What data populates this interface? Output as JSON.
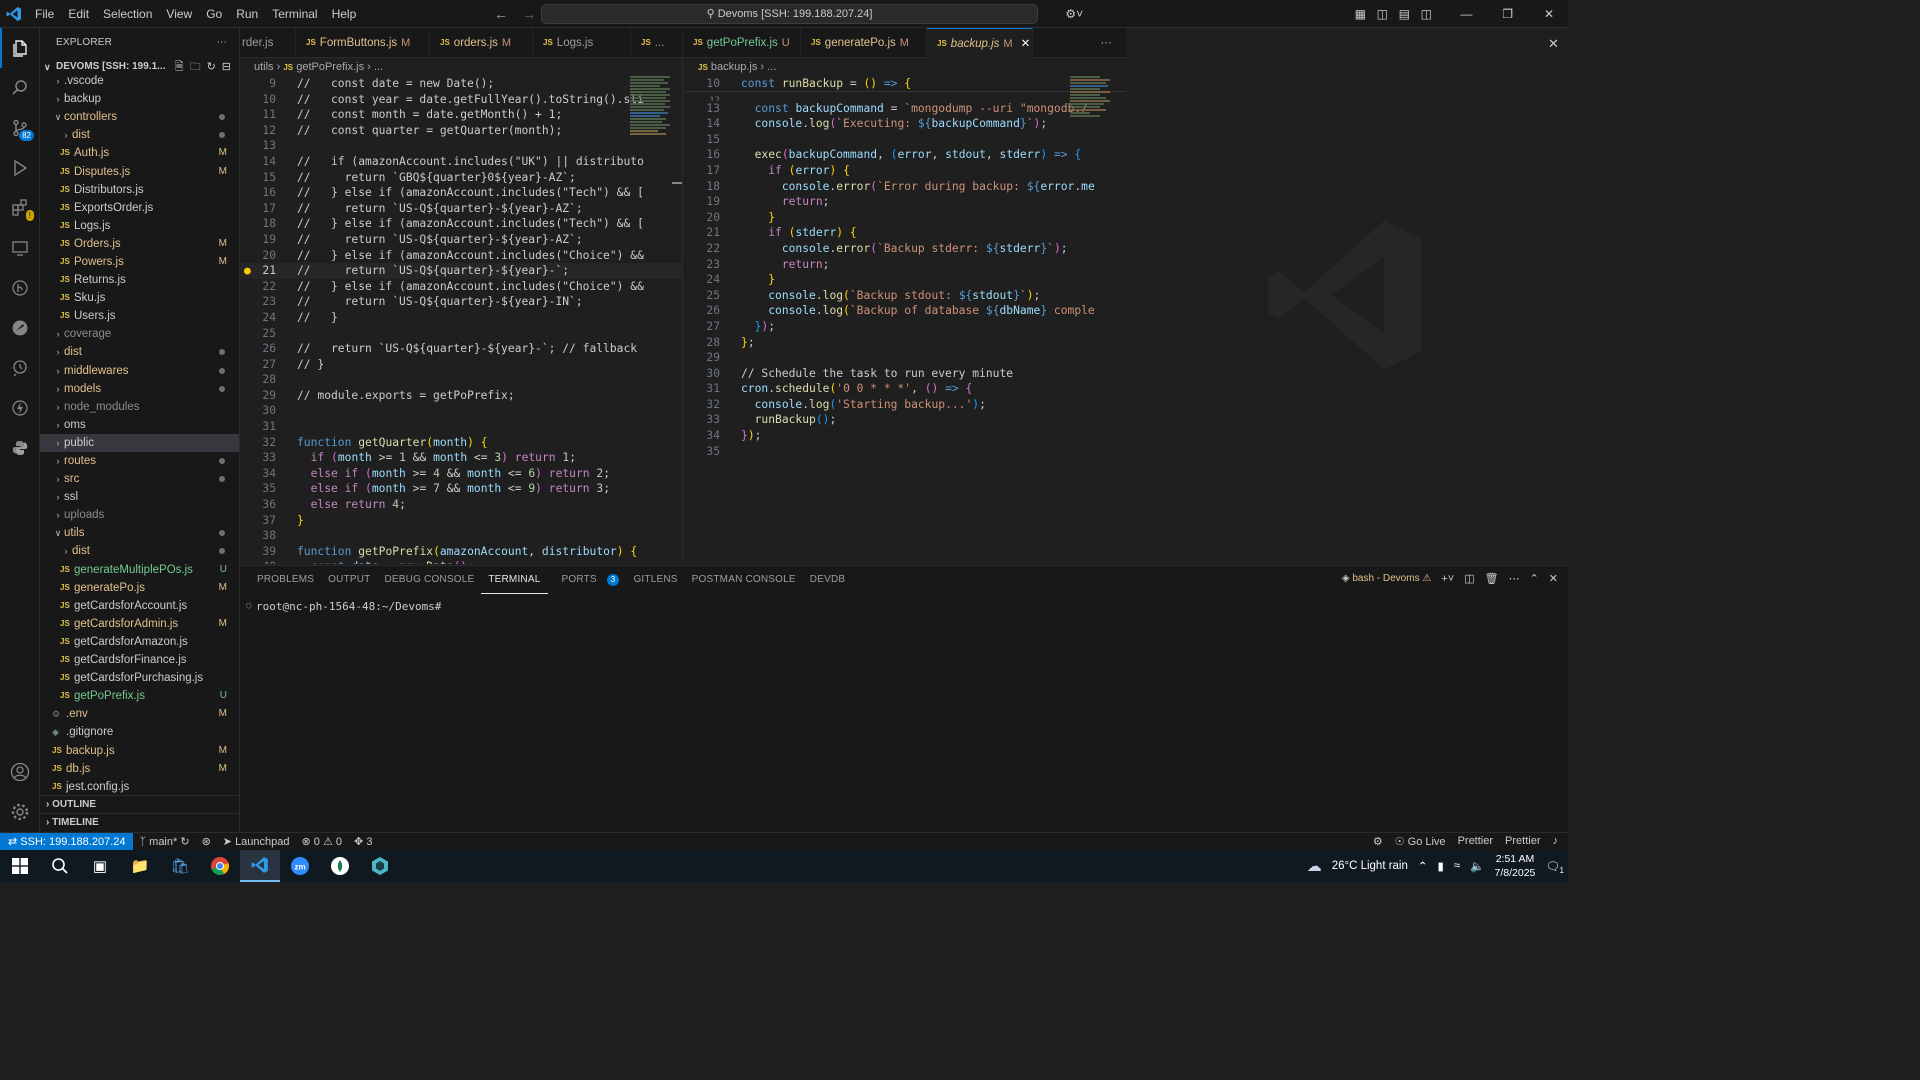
{
  "titlebar": {
    "menu": [
      "File",
      "Edit",
      "Selection",
      "View",
      "Go",
      "Run",
      "Terminal",
      "Help"
    ],
    "search": "Devoms [SSH: 199.188.207.24]"
  },
  "activity": {
    "source_control_badge": "82"
  },
  "explorer": {
    "title": "EXPLORER",
    "workspace": "DEVOMS [SSH: 199.1...",
    "items": [
      {
        "label": ".vscode",
        "type": "folder",
        "depth": 0,
        "color": "def"
      },
      {
        "label": "backup",
        "type": "folder",
        "depth": 0,
        "color": "def"
      },
      {
        "label": "controllers",
        "type": "folder-open",
        "depth": 0,
        "color": "mod",
        "dot": true
      },
      {
        "label": "dist",
        "type": "folder",
        "depth": 1,
        "color": "mod",
        "dot": true
      },
      {
        "label": "Auth.js",
        "type": "js",
        "depth": 1,
        "color": "mod",
        "badge": "M"
      },
      {
        "label": "Disputes.js",
        "type": "js",
        "depth": 1,
        "color": "mod",
        "badge": "M"
      },
      {
        "label": "Distributors.js",
        "type": "js",
        "depth": 1,
        "color": "def"
      },
      {
        "label": "ExportsOrder.js",
        "type": "js",
        "depth": 1,
        "color": "def"
      },
      {
        "label": "Logs.js",
        "type": "js",
        "depth": 1,
        "color": "def"
      },
      {
        "label": "Orders.js",
        "type": "js",
        "depth": 1,
        "color": "mod",
        "badge": "M"
      },
      {
        "label": "Powers.js",
        "type": "js",
        "depth": 1,
        "color": "mod",
        "badge": "M"
      },
      {
        "label": "Returns.js",
        "type": "js",
        "depth": 1,
        "color": "def"
      },
      {
        "label": "Sku.js",
        "type": "js",
        "depth": 1,
        "color": "def"
      },
      {
        "label": "Users.js",
        "type": "js",
        "depth": 1,
        "color": "def"
      },
      {
        "label": "coverage",
        "type": "folder",
        "depth": 0,
        "color": "ign"
      },
      {
        "label": "dist",
        "type": "folder",
        "depth": 0,
        "color": "mod",
        "dot": true
      },
      {
        "label": "middlewares",
        "type": "folder",
        "depth": 0,
        "color": "mod",
        "dot": true
      },
      {
        "label": "models",
        "type": "folder",
        "depth": 0,
        "color": "mod",
        "dot": true
      },
      {
        "label": "node_modules",
        "type": "folder",
        "depth": 0,
        "color": "ign"
      },
      {
        "label": "oms",
        "type": "folder",
        "depth": 0,
        "color": "def"
      },
      {
        "label": "public",
        "type": "folder",
        "depth": 0,
        "color": "def",
        "selected": true
      },
      {
        "label": "routes",
        "type": "folder",
        "depth": 0,
        "color": "mod",
        "dot": true
      },
      {
        "label": "src",
        "type": "folder",
        "depth": 0,
        "color": "mod",
        "dot": true
      },
      {
        "label": "ssl",
        "type": "folder",
        "depth": 0,
        "color": "def"
      },
      {
        "label": "uploads",
        "type": "folder",
        "depth": 0,
        "color": "ign"
      },
      {
        "label": "utils",
        "type": "folder-open",
        "depth": 0,
        "color": "mod",
        "dot": true
      },
      {
        "label": "dist",
        "type": "folder",
        "depth": 1,
        "color": "mod",
        "dot": true
      },
      {
        "label": "generateMultiplePOs.js",
        "type": "js",
        "depth": 1,
        "color": "new",
        "badge": "U"
      },
      {
        "label": "generatePo.js",
        "type": "js",
        "depth": 1,
        "color": "mod",
        "badge": "M"
      },
      {
        "label": "getCardsforAccount.js",
        "type": "js",
        "depth": 1,
        "color": "def"
      },
      {
        "label": "getCardsforAdmin.js",
        "type": "js",
        "depth": 1,
        "color": "mod",
        "badge": "M"
      },
      {
        "label": "getCardsforAmazon.js",
        "type": "js",
        "depth": 1,
        "color": "def"
      },
      {
        "label": "getCardsforFinance.js",
        "type": "js",
        "depth": 1,
        "color": "def"
      },
      {
        "label": "getCardsforPurchasing.js",
        "type": "js",
        "depth": 1,
        "color": "def"
      },
      {
        "label": "getPoPrefix.js",
        "type": "js",
        "depth": 1,
        "color": "new",
        "badge": "U"
      },
      {
        "label": ".env",
        "type": "cfg",
        "depth": 0,
        "color": "mod",
        "badge": "M"
      },
      {
        "label": ".gitignore",
        "type": "git",
        "depth": 0,
        "color": "def"
      },
      {
        "label": "backup.js",
        "type": "js",
        "depth": 0,
        "color": "mod",
        "badge": "M"
      },
      {
        "label": "db.js",
        "type": "js",
        "depth": 0,
        "color": "mod",
        "badge": "M"
      },
      {
        "label": "jest.config.js",
        "type": "js",
        "depth": 0,
        "color": "def"
      }
    ],
    "outline": "OUTLINE",
    "timeline": "TIMELINE"
  },
  "tabs": [
    {
      "label": "rder.js",
      "state": ""
    },
    {
      "label": "FormButtons.js",
      "state": "M"
    },
    {
      "label": "orders.js",
      "state": "M"
    },
    {
      "label": "Logs.js",
      "state": ""
    },
    {
      "label": "",
      "state": "..."
    },
    {
      "label": "getPoPrefix.js",
      "state": "U"
    },
    {
      "label": "generatePo.js",
      "state": "M"
    },
    {
      "label": "backup.js",
      "state": "M",
      "active": true
    }
  ],
  "left_editor": {
    "breadcrumb": [
      "utils",
      "getPoPrefix.js",
      "..."
    ],
    "current_line": 21
  },
  "right_editor": {
    "breadcrumb": [
      "backup.js",
      "..."
    ]
  },
  "panel": {
    "tabs": [
      "PROBLEMS",
      "OUTPUT",
      "DEBUG CONSOLE",
      "TERMINAL",
      "PORTS",
      "GITLENS",
      "POSTMAN CONSOLE",
      "DEVDB"
    ],
    "active_tab": "TERMINAL",
    "ports_count": "3",
    "terminal_name": "bash - Devoms",
    "prompt": "root@nc-ph-1564-48:~/Devoms#"
  },
  "statusbar": {
    "remote": "SSH: 199.188.207.24",
    "branch": "main*",
    "launchpad": "Launchpad",
    "errors": "0",
    "warnings": "0",
    "ports": "3",
    "go_live": "Go Live",
    "prettier1": "Prettier",
    "prettier2": "Prettier"
  },
  "taskbar": {
    "weather": "26°C  Light rain",
    "time": "2:51 AM",
    "date": "7/8/2025",
    "notif": "1"
  },
  "colors": {
    "accent": "#0078d4",
    "modified": "#e2c08d",
    "untracked": "#73c991"
  }
}
